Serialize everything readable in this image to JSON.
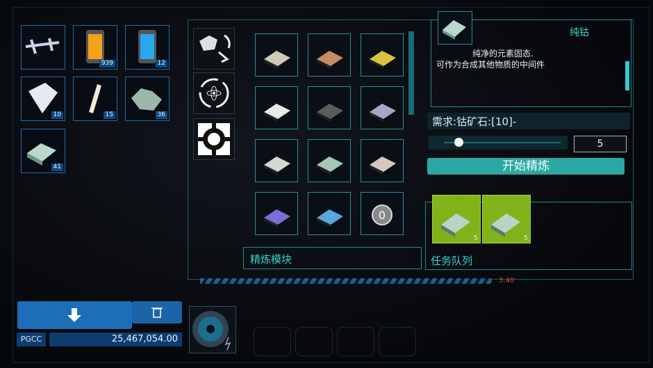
{
  "inventory": {
    "slots": [
      {
        "icon": "crossbow-icon",
        "count": ""
      },
      {
        "icon": "orange-canister-icon",
        "count": "939"
      },
      {
        "icon": "blue-canister-icon",
        "count": "12"
      },
      {
        "icon": "metal-plate-icon",
        "count": "10"
      },
      {
        "icon": "rod-icon",
        "count": "15"
      },
      {
        "icon": "ore-chunk-icon",
        "count": "36"
      },
      {
        "icon": "cobalt-ingot-icon",
        "count": "41"
      }
    ]
  },
  "tools": [
    {
      "icon": "ore-refine-icon"
    },
    {
      "icon": "atom-recycle-icon"
    },
    {
      "icon": "target-frame-icon"
    }
  ],
  "recipes": [
    {
      "icon": "ingot-icon",
      "color": "#cfc9b8"
    },
    {
      "icon": "ingot-icon",
      "color": "#c98b66"
    },
    {
      "icon": "ingot-icon",
      "color": "#d9c23f"
    },
    {
      "icon": "ingot-icon",
      "color": "#e8e8e8"
    },
    {
      "icon": "ingot-icon",
      "color": "#5c5c5c"
    },
    {
      "icon": "ingot-icon",
      "color": "#a7a9c4"
    },
    {
      "icon": "ingot-icon",
      "color": "#d4d6cf"
    },
    {
      "icon": "ingot-icon",
      "color": "#a4c6b8"
    },
    {
      "icon": "ingot-icon",
      "color": "#d9c6c0"
    },
    {
      "icon": "ingot-icon",
      "color": "#7b6ed6"
    },
    {
      "icon": "ingot-icon",
      "color": "#59a6e0"
    },
    {
      "icon": "orb-icon",
      "color": "#9a9a9a"
    }
  ],
  "refine_module_label": "精炼模块",
  "detail": {
    "title": "纯钴",
    "description_line1": "纯净的元素固态.",
    "description_line2": "可作为合成其他物质的中间件",
    "requirement": "需求:钴矿石:[10]-",
    "quantity": "5",
    "slider_level": 0.1,
    "start_button": "开始精炼"
  },
  "queue": {
    "label": "任务队列",
    "items": [
      {
        "count": "5"
      },
      {
        "count": "5"
      }
    ]
  },
  "progress_value": "3.40",
  "currency": {
    "label": "PGCC",
    "amount": "25,467,054.00"
  },
  "colors": {
    "teal": "#2aa9a2",
    "blue": "#1d6eb8",
    "queue_green": "#8bc21a"
  }
}
